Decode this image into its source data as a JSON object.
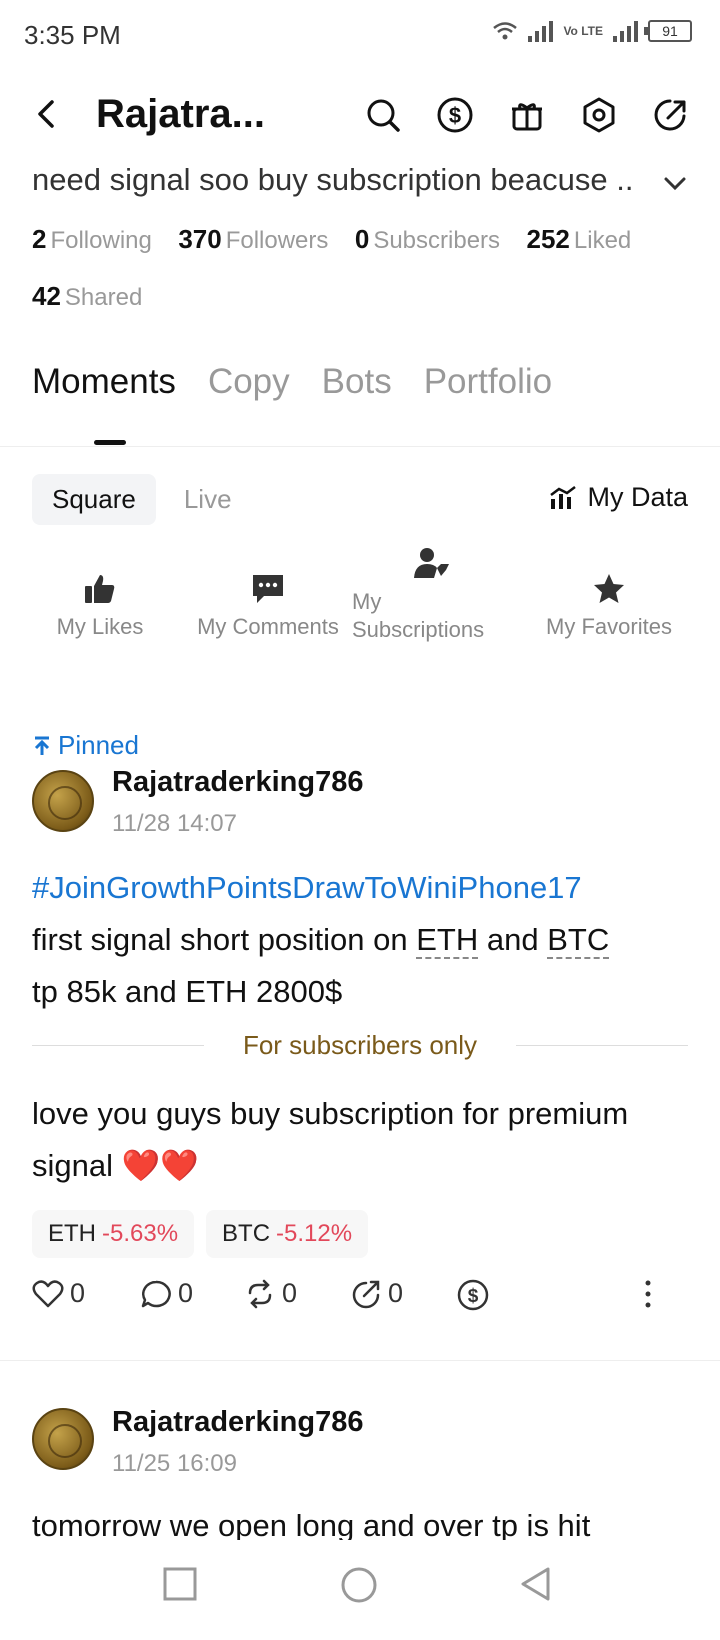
{
  "status_bar": {
    "time": "3:35 PM",
    "volte": "Vo LTE",
    "battery": "91"
  },
  "header": {
    "title": "Rajatra..."
  },
  "bio": "need signal soo buy subscription beacuse ..",
  "stats": [
    {
      "num": "2",
      "label": "Following"
    },
    {
      "num": "370",
      "label": "Followers"
    },
    {
      "num": "0",
      "label": "Subscribers"
    },
    {
      "num": "252",
      "label": "Liked"
    },
    {
      "num": "42",
      "label": "Shared"
    }
  ],
  "tabs": [
    "Moments",
    "Copy",
    "Bots",
    "Portfolio"
  ],
  "subtabs": [
    "Square",
    "Live"
  ],
  "my_data": "My Data",
  "shortcuts": [
    "My Likes",
    "My Comments",
    "My Subscriptions",
    "My Favorites"
  ],
  "posts": [
    {
      "pinned": "Pinned",
      "author": "Rajatraderking786",
      "time": "11/28 14:07",
      "hashtag": "#JoinGrowthPointsDrawToWiniPhone17",
      "text_part1": "first signal short position on ",
      "coin1": "ETH",
      "text_and": " and ",
      "coin2": "BTC",
      "text_part2": "tp 85k and ETH 2800$",
      "subscribers_only": "For subscribers only",
      "premium_text": "love you guys buy subscription for premium signal ❤️❤️",
      "tags": [
        {
          "symbol": "ETH",
          "change": "-5.63%"
        },
        {
          "symbol": "BTC",
          "change": "-5.12%"
        }
      ],
      "counts": {
        "likes": "0",
        "comments": "0",
        "reposts": "0",
        "shares": "0"
      }
    },
    {
      "author": "Rajatraderking786",
      "time": "11/25 16:09",
      "text": "tomorrow  we open long and over tp is hit"
    }
  ],
  "colors": {
    "link": "#1976d2",
    "negative": "#e2485a",
    "subscriber_text": "#7a5a1a"
  }
}
